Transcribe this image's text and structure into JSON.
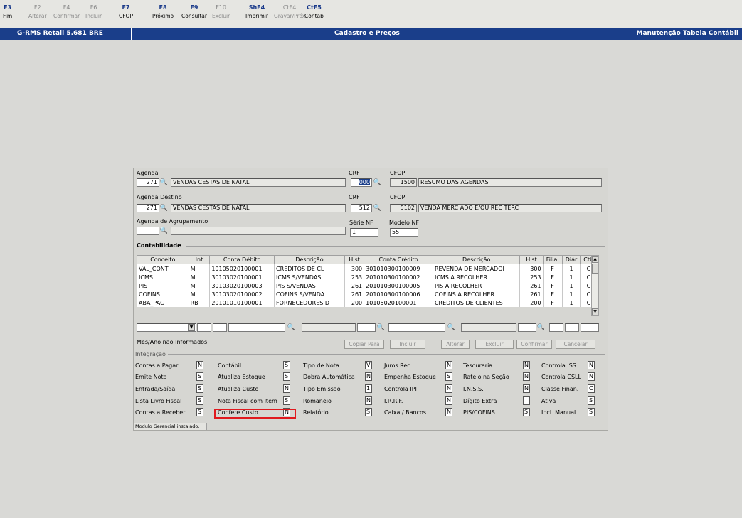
{
  "toolbar": {
    "keys": [
      {
        "key": "F3",
        "label": "Fim",
        "enabled": true
      },
      {
        "key": "F2",
        "label": "Alterar",
        "enabled": false
      },
      {
        "key": "F4",
        "label": "Confirmar",
        "enabled": false
      },
      {
        "key": "F6",
        "label": "Incluir",
        "enabled": false
      },
      {
        "key": "F7",
        "label": "CFOP",
        "enabled": true
      },
      {
        "key": "F8",
        "label": "Próximo",
        "enabled": true
      },
      {
        "key": "F9",
        "label": "Consultar",
        "enabled": true
      },
      {
        "key": "F10",
        "label": "Excluir",
        "enabled": false
      },
      {
        "key": "ShF4",
        "label": "Imprimir",
        "enabled": true
      },
      {
        "key": "CtF4",
        "label": "Gravar/Próx",
        "enabled": false
      },
      {
        "key": "CtF5",
        "label": "Contab",
        "enabled": true
      }
    ]
  },
  "titlebar": {
    "app": "G-RMS Retail 5.681 BRE",
    "screen": "Cadastro e Preços",
    "subtitle": "Manutenção Tabela Contábil",
    "color": "#1a3e8a"
  },
  "form": {
    "agenda_label": "Agenda",
    "agenda_code": "271",
    "agenda_desc": "VENDAS CESTAS DE NATAL",
    "crf_label": "CRF",
    "crf_value": "000",
    "cfop_label": "CFOP",
    "cfop_code": "1500",
    "cfop_desc": "RESUMO DAS AGENDAS",
    "agenda_dest_label": "Agenda Destino",
    "agenda_dest_code": "271",
    "agenda_dest_desc": "VENDAS CESTAS DE NATAL",
    "crf2_label": "CRF",
    "crf2_value": "512",
    "cfop2_label": "CFOP",
    "cfop2_code": "5102",
    "cfop2_desc": "VENDA MERC ADQ E/OU REC TERC",
    "agrup_label": "Agenda de Agrupamento",
    "agrup_code": "",
    "agrup_desc": "",
    "serie_label": "Série NF",
    "serie_value": "1",
    "modelo_label": "Modelo NF",
    "modelo_value": "55"
  },
  "contabilidade": {
    "title": "Contabilidade",
    "columns": [
      "Conceito",
      "Int",
      "Conta Débito",
      "Descrição",
      "Hist",
      "Conta Crédito",
      "Descrição",
      "Hist",
      "Filial",
      "Diár",
      "Ctb"
    ],
    "rows": [
      [
        "VAL_CONT",
        "M",
        "10105020100001",
        "CREDITOS DE CL",
        "300",
        "301010300100009",
        "REVENDA DE MERCADOI",
        "300",
        "F",
        "1",
        "C"
      ],
      [
        "ICMS",
        "M",
        "30103020100001",
        "ICMS S/VENDAS",
        "253",
        "201010300100002",
        "ICMS A RECOLHER",
        "253",
        "F",
        "1",
        "C"
      ],
      [
        "PIS",
        "M",
        "30103020100003",
        "PIS S/VENDAS",
        "261",
        "201010300100005",
        "PIS A RECOLHER",
        "261",
        "F",
        "1",
        "C"
      ],
      [
        "COFINS",
        "M",
        "30103020100002",
        "COFINS S/VENDA",
        "261",
        "201010300100006",
        "COFINS A RECOLHER",
        "261",
        "F",
        "1",
        "C"
      ],
      [
        "ABA_PAG",
        "RB",
        "20101010100001",
        "FORNECEDORES D",
        "200",
        "10105020100001",
        "CREDITOS DE CLIENTES",
        "200",
        "F",
        "1",
        "C"
      ]
    ],
    "message": "Mes/Ano não Informados",
    "buttons": [
      "Copiar Para",
      "Incluir",
      "Alterar",
      "Excluir",
      "Confirmar",
      "Cancelar"
    ]
  },
  "integracao": {
    "title": "Integração",
    "items": [
      {
        "label": "Contas a Pagar",
        "value": "N"
      },
      {
        "label": "Contábil",
        "value": "S"
      },
      {
        "label": "Tipo de Nota",
        "value": "V"
      },
      {
        "label": "Juros Rec.",
        "value": "N"
      },
      {
        "label": "Tesouraria",
        "value": "N"
      },
      {
        "label": "Controla ISS",
        "value": "N"
      },
      {
        "label": "Emite Nota",
        "value": "S"
      },
      {
        "label": "Atualiza Estoque",
        "value": "S"
      },
      {
        "label": "Dobra Automática",
        "value": "N"
      },
      {
        "label": "Empenha Estoque",
        "value": "S"
      },
      {
        "label": "Rateio na Seção",
        "value": "N"
      },
      {
        "label": "Controla CSLL",
        "value": "N"
      },
      {
        "label": "Entrada/Saída",
        "value": "S"
      },
      {
        "label": "Atualiza Custo",
        "value": "N"
      },
      {
        "label": "Tipo Emissão",
        "value": "1"
      },
      {
        "label": "Controla IPI",
        "value": "N"
      },
      {
        "label": "I.N.S.S.",
        "value": "N"
      },
      {
        "label": "Classe Finan.",
        "value": "C"
      },
      {
        "label": "Lista Livro Fiscal",
        "value": "S"
      },
      {
        "label": "Nota Fiscal com Item",
        "value": "S"
      },
      {
        "label": "Romaneio",
        "value": "N"
      },
      {
        "label": "I.R.R.F.",
        "value": "N"
      },
      {
        "label": "Dígito Extra",
        "value": ""
      },
      {
        "label": "Ativa",
        "value": "S"
      },
      {
        "label": "Contas a Receber",
        "value": "S"
      },
      {
        "label": "Confere Custo",
        "value": "N"
      },
      {
        "label": "Relatório",
        "value": "S"
      },
      {
        "label": "Caixa / Bancos",
        "value": "N"
      },
      {
        "label": "PIS/COFINS",
        "value": "S"
      },
      {
        "label": "Incl. Manual",
        "value": "S"
      }
    ]
  },
  "status": "Modulo Gerencial instalado.",
  "highlight_color": "#e0191e"
}
